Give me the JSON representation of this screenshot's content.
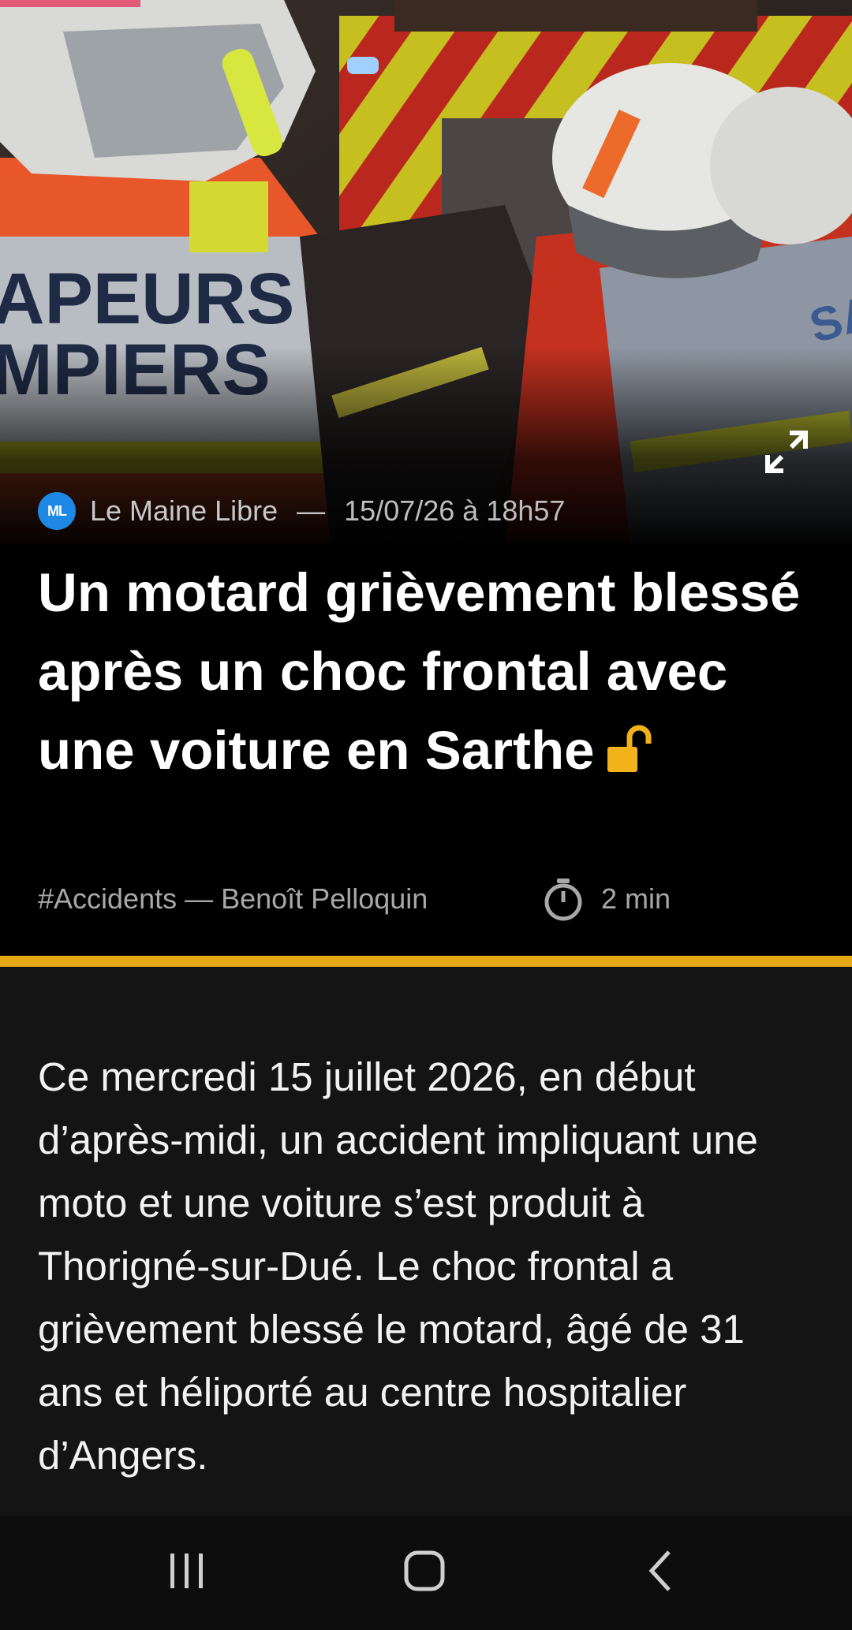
{
  "article": {
    "source": "Le Maine Libre",
    "source_logo_text": "ML",
    "meta_separator": "—",
    "date": "15/07/26 à 18h57",
    "title": "Un motard grièvement blessé après un choc frontal avec une voiture en Sarthe",
    "category": "#Accidents",
    "author": "Benoît Pelloquin",
    "byline": "#Accidents — Benoît Pelloquin",
    "read_time": "2 min",
    "lead": "Ce mercredi 15 juillet 2026, en début d’après-midi, un accident impliquant une moto et une voiture s’est produit à Thorigné-sur-Dué. Le choc frontal a grièvement blessé le motard, âgé de 31 ans et héliporté au centre hospitalier d’Angers."
  },
  "hero": {
    "photo_text_line1": "APEURS",
    "photo_text_line2": "MPIERS",
    "photo_text_side": "SAI"
  },
  "icons": {
    "expand": "expand-icon",
    "lock": "unlocked-padlock-icon",
    "timer": "stopwatch-icon",
    "recents": "recent-apps-icon",
    "home": "home-icon",
    "back": "back-icon"
  },
  "colors": {
    "accent": "#e5a817",
    "lock": "#f2b21a",
    "source_logo": "#1e88e5"
  }
}
